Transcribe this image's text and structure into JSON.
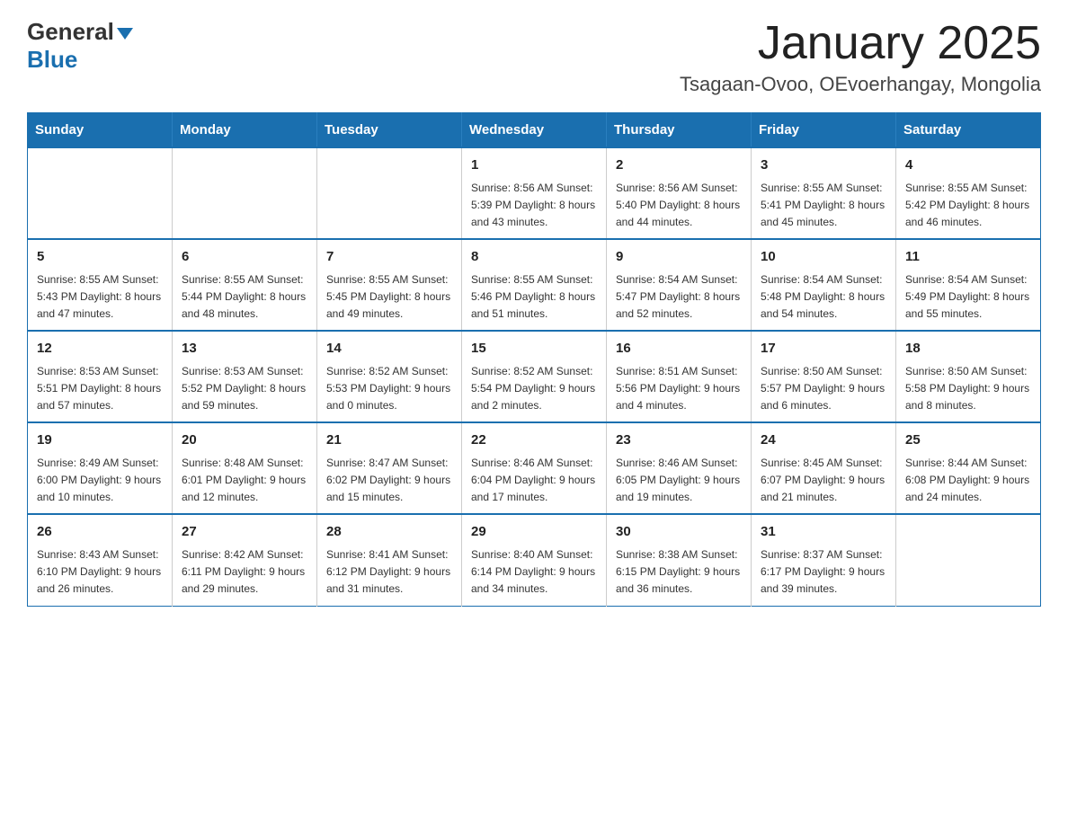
{
  "logo": {
    "general": "General",
    "blue": "Blue"
  },
  "title": "January 2025",
  "subtitle": "Tsagaan-Ovoo, OEvoerhangay, Mongolia",
  "days_of_week": [
    "Sunday",
    "Monday",
    "Tuesday",
    "Wednesday",
    "Thursday",
    "Friday",
    "Saturday"
  ],
  "weeks": [
    [
      {
        "day": "",
        "info": ""
      },
      {
        "day": "",
        "info": ""
      },
      {
        "day": "",
        "info": ""
      },
      {
        "day": "1",
        "info": "Sunrise: 8:56 AM\nSunset: 5:39 PM\nDaylight: 8 hours\nand 43 minutes."
      },
      {
        "day": "2",
        "info": "Sunrise: 8:56 AM\nSunset: 5:40 PM\nDaylight: 8 hours\nand 44 minutes."
      },
      {
        "day": "3",
        "info": "Sunrise: 8:55 AM\nSunset: 5:41 PM\nDaylight: 8 hours\nand 45 minutes."
      },
      {
        "day": "4",
        "info": "Sunrise: 8:55 AM\nSunset: 5:42 PM\nDaylight: 8 hours\nand 46 minutes."
      }
    ],
    [
      {
        "day": "5",
        "info": "Sunrise: 8:55 AM\nSunset: 5:43 PM\nDaylight: 8 hours\nand 47 minutes."
      },
      {
        "day": "6",
        "info": "Sunrise: 8:55 AM\nSunset: 5:44 PM\nDaylight: 8 hours\nand 48 minutes."
      },
      {
        "day": "7",
        "info": "Sunrise: 8:55 AM\nSunset: 5:45 PM\nDaylight: 8 hours\nand 49 minutes."
      },
      {
        "day": "8",
        "info": "Sunrise: 8:55 AM\nSunset: 5:46 PM\nDaylight: 8 hours\nand 51 minutes."
      },
      {
        "day": "9",
        "info": "Sunrise: 8:54 AM\nSunset: 5:47 PM\nDaylight: 8 hours\nand 52 minutes."
      },
      {
        "day": "10",
        "info": "Sunrise: 8:54 AM\nSunset: 5:48 PM\nDaylight: 8 hours\nand 54 minutes."
      },
      {
        "day": "11",
        "info": "Sunrise: 8:54 AM\nSunset: 5:49 PM\nDaylight: 8 hours\nand 55 minutes."
      }
    ],
    [
      {
        "day": "12",
        "info": "Sunrise: 8:53 AM\nSunset: 5:51 PM\nDaylight: 8 hours\nand 57 minutes."
      },
      {
        "day": "13",
        "info": "Sunrise: 8:53 AM\nSunset: 5:52 PM\nDaylight: 8 hours\nand 59 minutes."
      },
      {
        "day": "14",
        "info": "Sunrise: 8:52 AM\nSunset: 5:53 PM\nDaylight: 9 hours\nand 0 minutes."
      },
      {
        "day": "15",
        "info": "Sunrise: 8:52 AM\nSunset: 5:54 PM\nDaylight: 9 hours\nand 2 minutes."
      },
      {
        "day": "16",
        "info": "Sunrise: 8:51 AM\nSunset: 5:56 PM\nDaylight: 9 hours\nand 4 minutes."
      },
      {
        "day": "17",
        "info": "Sunrise: 8:50 AM\nSunset: 5:57 PM\nDaylight: 9 hours\nand 6 minutes."
      },
      {
        "day": "18",
        "info": "Sunrise: 8:50 AM\nSunset: 5:58 PM\nDaylight: 9 hours\nand 8 minutes."
      }
    ],
    [
      {
        "day": "19",
        "info": "Sunrise: 8:49 AM\nSunset: 6:00 PM\nDaylight: 9 hours\nand 10 minutes."
      },
      {
        "day": "20",
        "info": "Sunrise: 8:48 AM\nSunset: 6:01 PM\nDaylight: 9 hours\nand 12 minutes."
      },
      {
        "day": "21",
        "info": "Sunrise: 8:47 AM\nSunset: 6:02 PM\nDaylight: 9 hours\nand 15 minutes."
      },
      {
        "day": "22",
        "info": "Sunrise: 8:46 AM\nSunset: 6:04 PM\nDaylight: 9 hours\nand 17 minutes."
      },
      {
        "day": "23",
        "info": "Sunrise: 8:46 AM\nSunset: 6:05 PM\nDaylight: 9 hours\nand 19 minutes."
      },
      {
        "day": "24",
        "info": "Sunrise: 8:45 AM\nSunset: 6:07 PM\nDaylight: 9 hours\nand 21 minutes."
      },
      {
        "day": "25",
        "info": "Sunrise: 8:44 AM\nSunset: 6:08 PM\nDaylight: 9 hours\nand 24 minutes."
      }
    ],
    [
      {
        "day": "26",
        "info": "Sunrise: 8:43 AM\nSunset: 6:10 PM\nDaylight: 9 hours\nand 26 minutes."
      },
      {
        "day": "27",
        "info": "Sunrise: 8:42 AM\nSunset: 6:11 PM\nDaylight: 9 hours\nand 29 minutes."
      },
      {
        "day": "28",
        "info": "Sunrise: 8:41 AM\nSunset: 6:12 PM\nDaylight: 9 hours\nand 31 minutes."
      },
      {
        "day": "29",
        "info": "Sunrise: 8:40 AM\nSunset: 6:14 PM\nDaylight: 9 hours\nand 34 minutes."
      },
      {
        "day": "30",
        "info": "Sunrise: 8:38 AM\nSunset: 6:15 PM\nDaylight: 9 hours\nand 36 minutes."
      },
      {
        "day": "31",
        "info": "Sunrise: 8:37 AM\nSunset: 6:17 PM\nDaylight: 9 hours\nand 39 minutes."
      },
      {
        "day": "",
        "info": ""
      }
    ]
  ]
}
